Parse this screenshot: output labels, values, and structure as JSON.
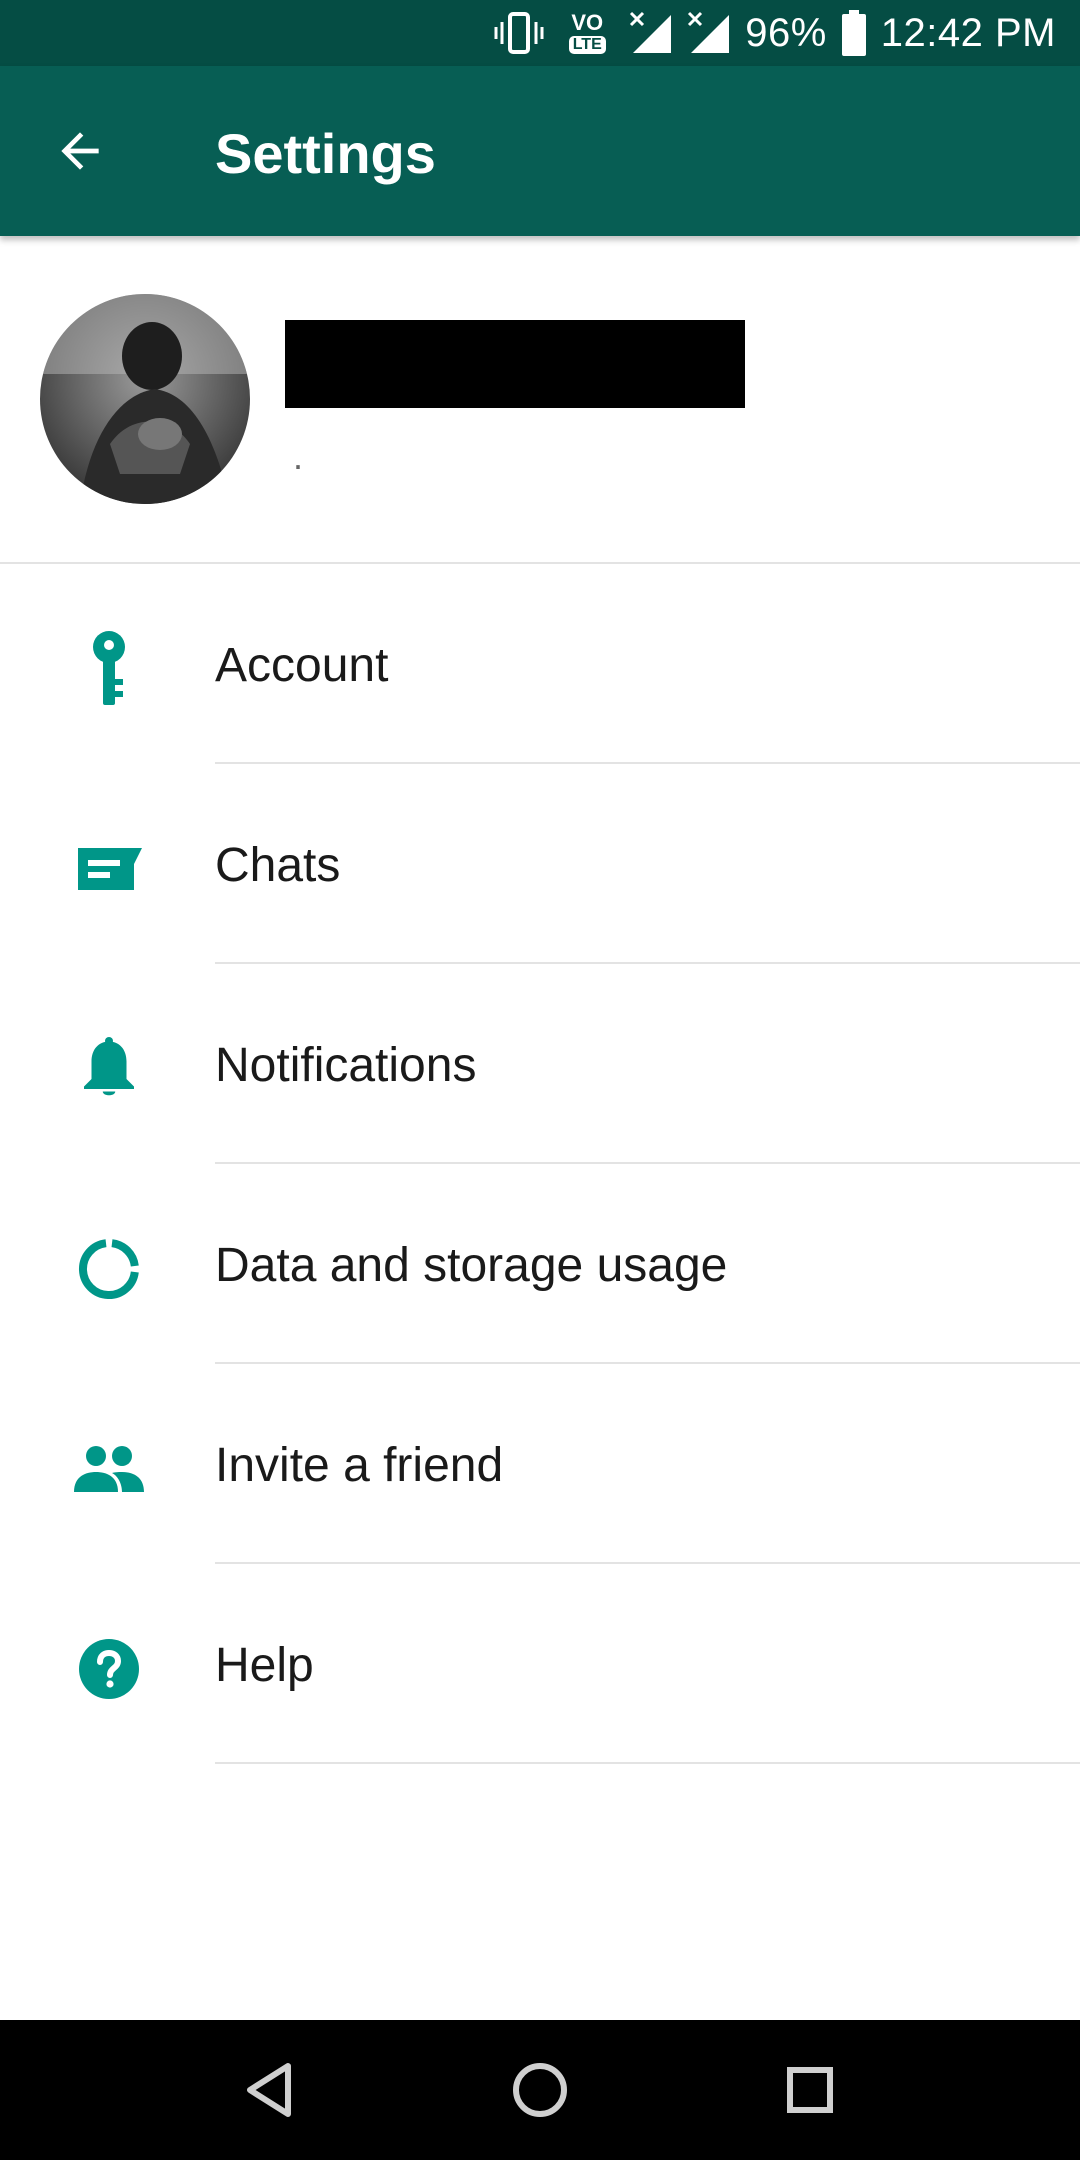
{
  "status_bar": {
    "battery": "96%",
    "time": "12:42 PM",
    "icons": [
      "vibrate-icon",
      "volte-icon",
      "signal-icon",
      "signal-icon",
      "battery-icon"
    ],
    "volte_top": "VO",
    "volte_bottom": "LTE"
  },
  "app_bar": {
    "title": "Settings",
    "back_icon": "arrow-back-icon",
    "background": "#075e54"
  },
  "profile": {
    "name": "",
    "status": "."
  },
  "settings": {
    "accent_color": "#009688",
    "items": [
      {
        "label": "Account",
        "icon": "key-icon"
      },
      {
        "label": "Chats",
        "icon": "chat-icon"
      },
      {
        "label": "Notifications",
        "icon": "bell-icon"
      },
      {
        "label": "Data and storage usage",
        "icon": "data-usage-icon"
      },
      {
        "label": "Invite a friend",
        "icon": "people-icon"
      },
      {
        "label": "Help",
        "icon": "help-icon"
      }
    ]
  },
  "nav_bar": {
    "buttons": [
      "back-icon",
      "home-icon",
      "recents-icon"
    ]
  }
}
